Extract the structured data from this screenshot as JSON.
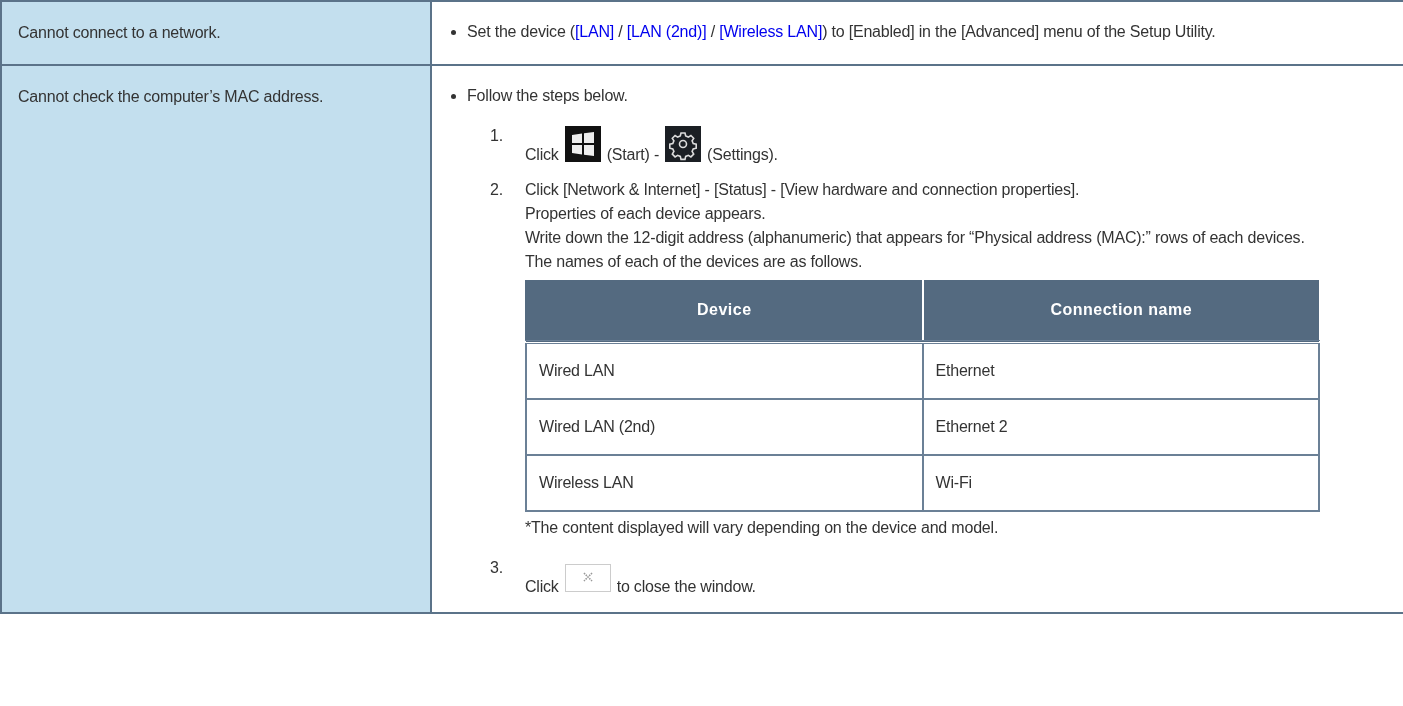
{
  "rows": [
    {
      "problem": "Cannot connect to a network.",
      "bullets": [
        {
          "parts": [
            {
              "kind": "text",
              "text": "Set the device ("
            },
            {
              "kind": "link",
              "text": "[LAN]"
            },
            {
              "kind": "text",
              "text": " / "
            },
            {
              "kind": "link",
              "text": "[LAN (2nd)]"
            },
            {
              "kind": "text",
              "text": " / "
            },
            {
              "kind": "link",
              "text": "[Wireless LAN]"
            },
            {
              "kind": "text",
              "text": ") to [Enabled] in the [Advanced] menu of the Setup Utility."
            }
          ]
        }
      ]
    },
    {
      "problem": "Cannot check the computer’s MAC address.",
      "bullets": [
        {
          "parts": [
            {
              "kind": "text",
              "text": "Follow the steps below."
            }
          ],
          "steps": [
            {
              "number": "1.",
              "parts": [
                {
                  "kind": "text",
                  "text": "Click"
                },
                {
                  "kind": "start"
                },
                {
                  "kind": "text",
                  "text": "(Start) -"
                },
                {
                  "kind": "gear"
                },
                {
                  "kind": "text",
                  "text": "(Settings)."
                }
              ]
            },
            {
              "number": "2.",
              "lines": [
                "Click [Network & Internet] - [Status] - [View hardware and connection properties].",
                "Properties of each device appears.",
                "Write down the 12-digit address (alphanumeric) that appears for “Physical address (MAC):” rows of each devices.",
                "The names of each of the devices are as follows."
              ],
              "table": {
                "columns": [
                  "Device",
                  "Connection name"
                ],
                "rows": [
                  [
                    "Wired LAN",
                    "Ethernet"
                  ],
                  [
                    "Wired LAN (2nd)",
                    "Ethernet 2"
                  ],
                  [
                    "Wireless LAN",
                    "Wi-Fi"
                  ]
                ]
              },
              "note": "*The content displayed will vary depending on the device and model."
            },
            {
              "number": "3.",
              "parts": [
                {
                  "kind": "text",
                  "text": "Click"
                },
                {
                  "kind": "close"
                },
                {
                  "kind": "text",
                  "text": "to close the window."
                }
              ]
            }
          ]
        }
      ]
    }
  ]
}
